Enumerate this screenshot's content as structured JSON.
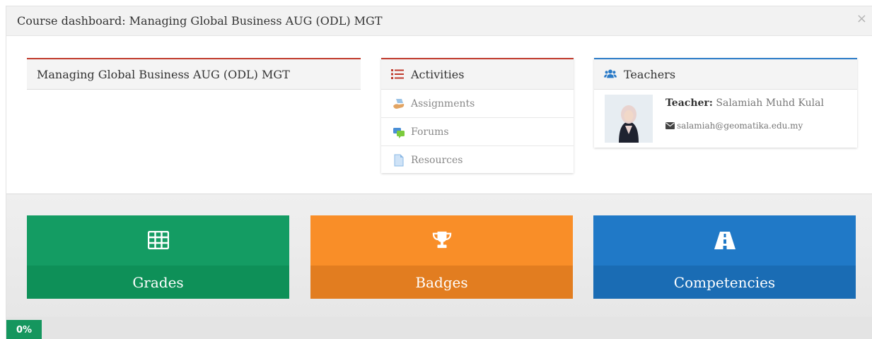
{
  "modal": {
    "title": "Course dashboard: Managing Global Business AUG (ODL) MGT",
    "close_label": "×"
  },
  "course_card": {
    "title": "Managing Global Business AUG (ODL) MGT"
  },
  "activities": {
    "title": "Activities",
    "icon": "list-icon",
    "items": [
      {
        "label": "Assignments",
        "icon": "assignment-icon"
      },
      {
        "label": "Forums",
        "icon": "forum-icon"
      },
      {
        "label": "Resources",
        "icon": "resource-icon"
      }
    ]
  },
  "teachers": {
    "title": "Teachers",
    "icon": "users-icon",
    "teacher_label": "Teacher:",
    "teacher_name": "Salamiah Muhd Kulal",
    "email": "salamiah@geomatika.edu.my"
  },
  "tiles": [
    {
      "label": "Grades",
      "icon": "table-icon",
      "color": "#149c63"
    },
    {
      "label": "Badges",
      "icon": "trophy-icon",
      "color": "#f98e28"
    },
    {
      "label": "Competencies",
      "icon": "road-icon",
      "color": "#2079c7"
    }
  ],
  "progress": {
    "label": "0%",
    "value": 0
  },
  "colors": {
    "accent_red": "#c0392b",
    "accent_blue": "#2a7ac7",
    "progress_green": "#15965e"
  }
}
